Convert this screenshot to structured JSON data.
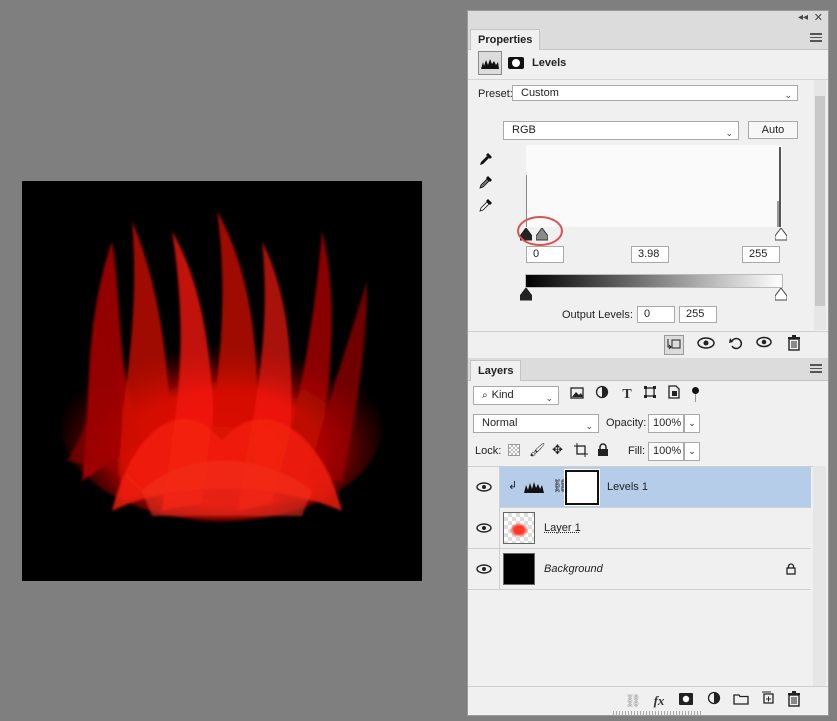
{
  "properties": {
    "tab_label": "Properties",
    "adjustment_name": "Levels",
    "preset_label": "Preset:",
    "preset_value": "Custom",
    "channel_value": "RGB",
    "auto_label": "Auto",
    "input_black": "0",
    "input_gamma": "3.98",
    "input_white": "255",
    "output_label": "Output Levels:",
    "output_black": "0",
    "output_white": "255"
  },
  "layers": {
    "tab_label": "Layers",
    "filter_value": "Kind",
    "blend_mode": "Normal",
    "opacity_label": "Opacity:",
    "opacity_value": "100%",
    "lock_label": "Lock:",
    "fill_label": "Fill:",
    "fill_value": "100%",
    "items": [
      {
        "name": "Levels 1",
        "selected": true
      },
      {
        "name": "Layer 1",
        "selected": false
      },
      {
        "name": "Background",
        "selected": false,
        "locked": true
      }
    ]
  },
  "colors": {
    "selection": "#b5cde9",
    "annotation_circle": "#d9534f",
    "flame": "#ff1a0f"
  },
  "icons": {
    "eye": "eye-icon",
    "lock": "lock-icon",
    "link": "chain-link-icon"
  }
}
